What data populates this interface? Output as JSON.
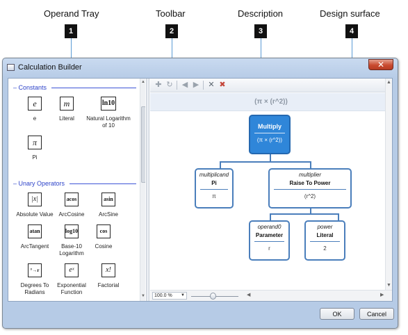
{
  "callouts": {
    "operand_tray": {
      "title": "Operand Tray",
      "badge": "1"
    },
    "toolbar": {
      "title": "Toolbar",
      "badge": "2"
    },
    "description": {
      "title": "Description",
      "badge": "3"
    },
    "design_surface": {
      "title": "Design surface",
      "badge": "4"
    }
  },
  "window": {
    "title": "Calculation Builder",
    "close_label": "✕"
  },
  "tray": {
    "groups": [
      {
        "name": "Constants",
        "items": [
          {
            "label": "e",
            "icon": "e"
          },
          {
            "label": "Literal",
            "icon": "m"
          },
          {
            "label": "Natural Logarithm of 10",
            "icon": "ln10"
          },
          {
            "label": "Pi",
            "icon": "π"
          }
        ]
      },
      {
        "name": "Unary Operators",
        "items": [
          {
            "label": "Absolute Value",
            "icon": "|x|"
          },
          {
            "label": "ArcCosine",
            "icon": "acos"
          },
          {
            "label": "ArcSine",
            "icon": "asin"
          },
          {
            "label": "ArcTangent",
            "icon": "atan"
          },
          {
            "label": "Base-10 Logarithm",
            "icon": "log10"
          },
          {
            "label": "Cosine",
            "icon": "cos"
          },
          {
            "label": "Degrees To Radians",
            "icon": "°→r"
          },
          {
            "label": "Exponential Function",
            "icon": "eˣ"
          },
          {
            "label": "Factorial",
            "icon": "x!"
          }
        ]
      }
    ]
  },
  "toolbar": {
    "icons": [
      "add-icon",
      "refresh-icon",
      "back-icon",
      "forward-icon",
      "delete-icon",
      "clear-icon"
    ]
  },
  "description": {
    "text": "(π × (r^2))"
  },
  "tree": {
    "root": {
      "name": "Multiply",
      "value": "(π × (r^2))"
    },
    "multiplicand": {
      "role": "multiplicand",
      "name": "Pi",
      "value": "π"
    },
    "multiplier": {
      "role": "multiplier",
      "name": "Raise To Power",
      "value": "(r^2)"
    },
    "operand0": {
      "role": "operand0",
      "name": "Parameter",
      "value": "r"
    },
    "power": {
      "role": "power",
      "name": "Literal",
      "value": "2"
    }
  },
  "status": {
    "zoom": "100.0 %"
  },
  "buttons": {
    "ok": "OK",
    "cancel": "Cancel"
  },
  "colors": {
    "accent": "#2f86d9",
    "node_border": "#4a7ebb",
    "group_header": "#2d43c9"
  }
}
